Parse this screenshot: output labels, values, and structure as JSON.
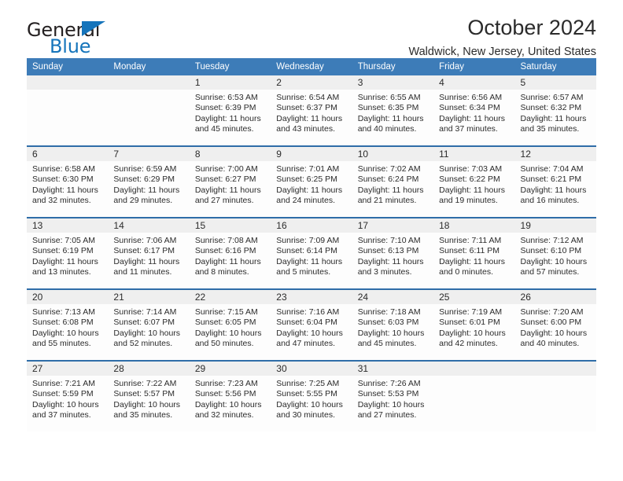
{
  "brand": {
    "word_one": "General",
    "word_two": "Blue",
    "accent_color": "#1574bb"
  },
  "header": {
    "title": "October 2024",
    "subtitle": "Waldwick, New Jersey, United States",
    "header_bg": "#3d7cb8",
    "daynum_bg": "#efefef"
  },
  "weekday_headers": [
    "Sunday",
    "Monday",
    "Tuesday",
    "Wednesday",
    "Thursday",
    "Friday",
    "Saturday"
  ],
  "labels": {
    "sunrise_prefix": "Sunrise:",
    "sunset_prefix": "Sunset:",
    "daylight_prefix": "Daylight:"
  },
  "weeks": [
    [
      {
        "day": "",
        "empty": true
      },
      {
        "day": "",
        "empty": true
      },
      {
        "day": "1",
        "sunrise": "Sunrise: 6:53 AM",
        "sunset": "Sunset: 6:39 PM",
        "daylight_line1": "Daylight: 11 hours",
        "daylight_line2": "and 45 minutes."
      },
      {
        "day": "2",
        "sunrise": "Sunrise: 6:54 AM",
        "sunset": "Sunset: 6:37 PM",
        "daylight_line1": "Daylight: 11 hours",
        "daylight_line2": "and 43 minutes."
      },
      {
        "day": "3",
        "sunrise": "Sunrise: 6:55 AM",
        "sunset": "Sunset: 6:35 PM",
        "daylight_line1": "Daylight: 11 hours",
        "daylight_line2": "and 40 minutes."
      },
      {
        "day": "4",
        "sunrise": "Sunrise: 6:56 AM",
        "sunset": "Sunset: 6:34 PM",
        "daylight_line1": "Daylight: 11 hours",
        "daylight_line2": "and 37 minutes."
      },
      {
        "day": "5",
        "sunrise": "Sunrise: 6:57 AM",
        "sunset": "Sunset: 6:32 PM",
        "daylight_line1": "Daylight: 11 hours",
        "daylight_line2": "and 35 minutes."
      }
    ],
    [
      {
        "day": "6",
        "sunrise": "Sunrise: 6:58 AM",
        "sunset": "Sunset: 6:30 PM",
        "daylight_line1": "Daylight: 11 hours",
        "daylight_line2": "and 32 minutes."
      },
      {
        "day": "7",
        "sunrise": "Sunrise: 6:59 AM",
        "sunset": "Sunset: 6:29 PM",
        "daylight_line1": "Daylight: 11 hours",
        "daylight_line2": "and 29 minutes."
      },
      {
        "day": "8",
        "sunrise": "Sunrise: 7:00 AM",
        "sunset": "Sunset: 6:27 PM",
        "daylight_line1": "Daylight: 11 hours",
        "daylight_line2": "and 27 minutes."
      },
      {
        "day": "9",
        "sunrise": "Sunrise: 7:01 AM",
        "sunset": "Sunset: 6:25 PM",
        "daylight_line1": "Daylight: 11 hours",
        "daylight_line2": "and 24 minutes."
      },
      {
        "day": "10",
        "sunrise": "Sunrise: 7:02 AM",
        "sunset": "Sunset: 6:24 PM",
        "daylight_line1": "Daylight: 11 hours",
        "daylight_line2": "and 21 minutes."
      },
      {
        "day": "11",
        "sunrise": "Sunrise: 7:03 AM",
        "sunset": "Sunset: 6:22 PM",
        "daylight_line1": "Daylight: 11 hours",
        "daylight_line2": "and 19 minutes."
      },
      {
        "day": "12",
        "sunrise": "Sunrise: 7:04 AM",
        "sunset": "Sunset: 6:21 PM",
        "daylight_line1": "Daylight: 11 hours",
        "daylight_line2": "and 16 minutes."
      }
    ],
    [
      {
        "day": "13",
        "sunrise": "Sunrise: 7:05 AM",
        "sunset": "Sunset: 6:19 PM",
        "daylight_line1": "Daylight: 11 hours",
        "daylight_line2": "and 13 minutes."
      },
      {
        "day": "14",
        "sunrise": "Sunrise: 7:06 AM",
        "sunset": "Sunset: 6:17 PM",
        "daylight_line1": "Daylight: 11 hours",
        "daylight_line2": "and 11 minutes."
      },
      {
        "day": "15",
        "sunrise": "Sunrise: 7:08 AM",
        "sunset": "Sunset: 6:16 PM",
        "daylight_line1": "Daylight: 11 hours",
        "daylight_line2": "and 8 minutes."
      },
      {
        "day": "16",
        "sunrise": "Sunrise: 7:09 AM",
        "sunset": "Sunset: 6:14 PM",
        "daylight_line1": "Daylight: 11 hours",
        "daylight_line2": "and 5 minutes."
      },
      {
        "day": "17",
        "sunrise": "Sunrise: 7:10 AM",
        "sunset": "Sunset: 6:13 PM",
        "daylight_line1": "Daylight: 11 hours",
        "daylight_line2": "and 3 minutes."
      },
      {
        "day": "18",
        "sunrise": "Sunrise: 7:11 AM",
        "sunset": "Sunset: 6:11 PM",
        "daylight_line1": "Daylight: 11 hours",
        "daylight_line2": "and 0 minutes."
      },
      {
        "day": "19",
        "sunrise": "Sunrise: 7:12 AM",
        "sunset": "Sunset: 6:10 PM",
        "daylight_line1": "Daylight: 10 hours",
        "daylight_line2": "and 57 minutes."
      }
    ],
    [
      {
        "day": "20",
        "sunrise": "Sunrise: 7:13 AM",
        "sunset": "Sunset: 6:08 PM",
        "daylight_line1": "Daylight: 10 hours",
        "daylight_line2": "and 55 minutes."
      },
      {
        "day": "21",
        "sunrise": "Sunrise: 7:14 AM",
        "sunset": "Sunset: 6:07 PM",
        "daylight_line1": "Daylight: 10 hours",
        "daylight_line2": "and 52 minutes."
      },
      {
        "day": "22",
        "sunrise": "Sunrise: 7:15 AM",
        "sunset": "Sunset: 6:05 PM",
        "daylight_line1": "Daylight: 10 hours",
        "daylight_line2": "and 50 minutes."
      },
      {
        "day": "23",
        "sunrise": "Sunrise: 7:16 AM",
        "sunset": "Sunset: 6:04 PM",
        "daylight_line1": "Daylight: 10 hours",
        "daylight_line2": "and 47 minutes."
      },
      {
        "day": "24",
        "sunrise": "Sunrise: 7:18 AM",
        "sunset": "Sunset: 6:03 PM",
        "daylight_line1": "Daylight: 10 hours",
        "daylight_line2": "and 45 minutes."
      },
      {
        "day": "25",
        "sunrise": "Sunrise: 7:19 AM",
        "sunset": "Sunset: 6:01 PM",
        "daylight_line1": "Daylight: 10 hours",
        "daylight_line2": "and 42 minutes."
      },
      {
        "day": "26",
        "sunrise": "Sunrise: 7:20 AM",
        "sunset": "Sunset: 6:00 PM",
        "daylight_line1": "Daylight: 10 hours",
        "daylight_line2": "and 40 minutes."
      }
    ],
    [
      {
        "day": "27",
        "sunrise": "Sunrise: 7:21 AM",
        "sunset": "Sunset: 5:59 PM",
        "daylight_line1": "Daylight: 10 hours",
        "daylight_line2": "and 37 minutes."
      },
      {
        "day": "28",
        "sunrise": "Sunrise: 7:22 AM",
        "sunset": "Sunset: 5:57 PM",
        "daylight_line1": "Daylight: 10 hours",
        "daylight_line2": "and 35 minutes."
      },
      {
        "day": "29",
        "sunrise": "Sunrise: 7:23 AM",
        "sunset": "Sunset: 5:56 PM",
        "daylight_line1": "Daylight: 10 hours",
        "daylight_line2": "and 32 minutes."
      },
      {
        "day": "30",
        "sunrise": "Sunrise: 7:25 AM",
        "sunset": "Sunset: 5:55 PM",
        "daylight_line1": "Daylight: 10 hours",
        "daylight_line2": "and 30 minutes."
      },
      {
        "day": "31",
        "sunrise": "Sunrise: 7:26 AM",
        "sunset": "Sunset: 5:53 PM",
        "daylight_line1": "Daylight: 10 hours",
        "daylight_line2": "and 27 minutes."
      },
      {
        "day": "",
        "empty": true
      },
      {
        "day": "",
        "empty": true
      }
    ]
  ]
}
